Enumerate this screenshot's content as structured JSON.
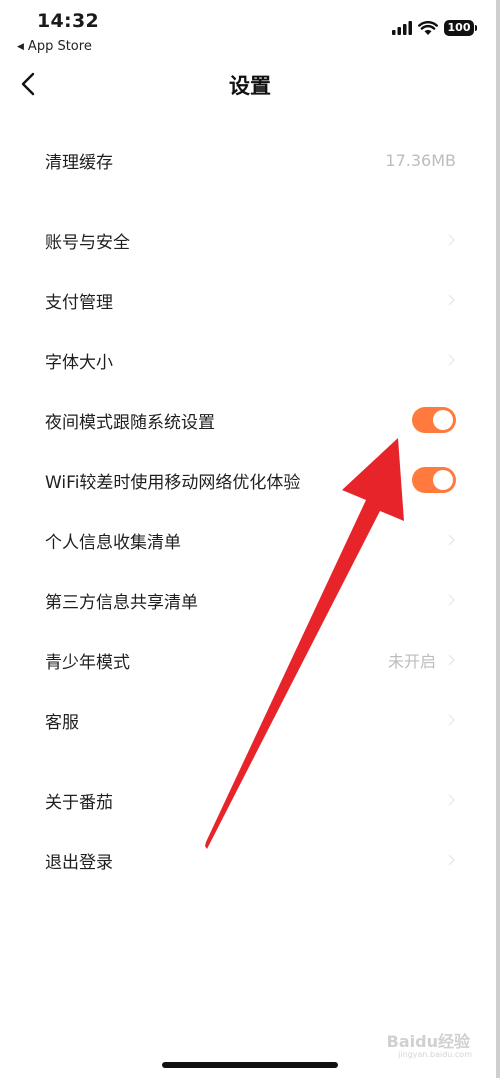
{
  "status_bar": {
    "time": "14:32",
    "back_app": "App Store",
    "battery": "100"
  },
  "nav": {
    "title": "设置"
  },
  "settings": {
    "clear_cache": {
      "label": "清理缓存",
      "value": "17.36MB"
    },
    "account_security": {
      "label": "账号与安全"
    },
    "payment": {
      "label": "支付管理"
    },
    "font_size": {
      "label": "字体大小"
    },
    "night_mode": {
      "label": "夜间模式跟随系统设置",
      "enabled": true
    },
    "wifi_optimize": {
      "label": "WiFi较差时使用移动网络优化体验",
      "enabled": true
    },
    "personal_info": {
      "label": "个人信息收集清单"
    },
    "third_party": {
      "label": "第三方信息共享清单"
    },
    "youth_mode": {
      "label": "青少年模式",
      "value": "未开启"
    },
    "customer_service": {
      "label": "客服"
    },
    "about": {
      "label": "关于番茄"
    },
    "logout": {
      "label": "退出登录"
    }
  },
  "watermark": {
    "text": "Baidu经验",
    "sub": "jingyan.baidu.com"
  },
  "colors": {
    "toggle_on": "#ff7a3c",
    "annotation_arrow": "#e8242b",
    "value_text": "#bdbdbd"
  }
}
